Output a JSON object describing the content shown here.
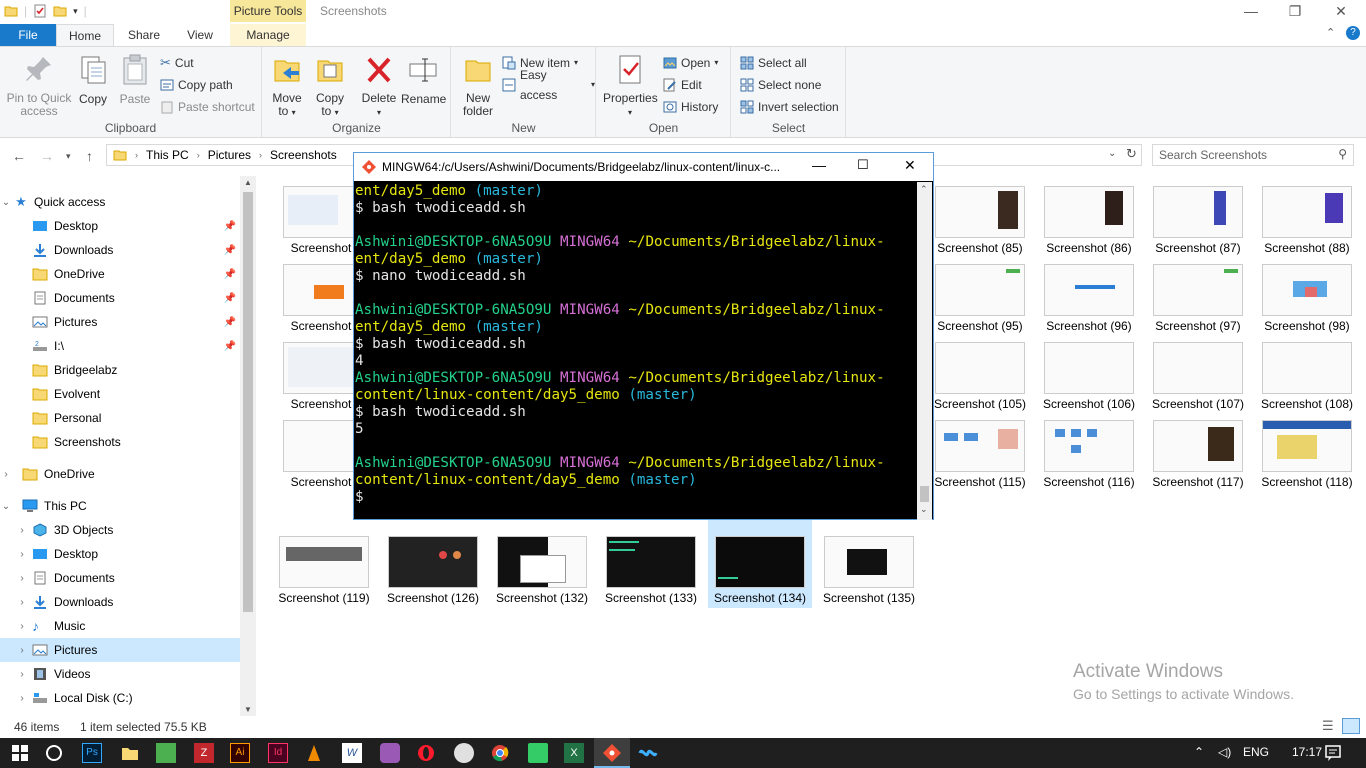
{
  "window": {
    "context_tab": "Picture Tools",
    "title": "Screenshots",
    "min": "—",
    "max": "❐",
    "close": "✕"
  },
  "tabs": {
    "file": "File",
    "home": "Home",
    "share": "Share",
    "view": "View",
    "manage": "Manage"
  },
  "ribbon": {
    "clipboard": {
      "label": "Clipboard",
      "pin": "Pin to Quick access",
      "copy": "Copy",
      "paste": "Paste",
      "cut": "Cut",
      "copy_path": "Copy path",
      "paste_shortcut": "Paste shortcut"
    },
    "organize": {
      "label": "Organize",
      "move_to": "Move to",
      "copy_to": "Copy to",
      "delete": "Delete",
      "rename": "Rename"
    },
    "new": {
      "label": "New",
      "new_folder": "New folder",
      "new_item": "New item",
      "easy_access": "Easy access"
    },
    "open": {
      "label": "Open",
      "properties": "Properties",
      "open": "Open",
      "edit": "Edit",
      "history": "History"
    },
    "select": {
      "label": "Select",
      "select_all": "Select all",
      "select_none": "Select none",
      "invert": "Invert selection"
    }
  },
  "address": {
    "crumbs": [
      "This PC",
      "Pictures",
      "Screenshots"
    ],
    "search_placeholder": "Search Screenshots"
  },
  "sidebar": {
    "quick_access": "Quick access",
    "items": [
      {
        "label": "Desktop",
        "pinned": true
      },
      {
        "label": "Downloads",
        "pinned": true
      },
      {
        "label": "OneDrive",
        "pinned": true
      },
      {
        "label": "Documents",
        "pinned": true
      },
      {
        "label": "Pictures",
        "pinned": true
      },
      {
        "label": "I:\\",
        "pinned": true
      },
      {
        "label": "Bridgeelabz",
        "pinned": false
      },
      {
        "label": "Evolvent",
        "pinned": false
      },
      {
        "label": "Personal",
        "pinned": false
      },
      {
        "label": "Screenshots",
        "pinned": false
      }
    ],
    "onedrive": "OneDrive",
    "this_pc": "This PC",
    "pc_items": [
      "3D Objects",
      "Desktop",
      "Documents",
      "Downloads",
      "Music",
      "Pictures",
      "Videos",
      "Local Disk (C:)"
    ]
  },
  "thumbnails": {
    "row1": [
      "Screenshot (8",
      "Screenshot (85)",
      "Screenshot (86)",
      "Screenshot (87)",
      "Screenshot (88)"
    ],
    "row2": [
      "Screenshot (9",
      "Screenshot (95)",
      "Screenshot (96)",
      "Screenshot (97)",
      "Screenshot (98)"
    ],
    "row3": [
      "Screenshot (1",
      "Screenshot (105)",
      "Screenshot (106)",
      "Screenshot (107)",
      "Screenshot (108)"
    ],
    "row4": [
      "Screenshot (1",
      "Screenshot (115)",
      "Screenshot (116)",
      "Screenshot (117)",
      "Screenshot (118)"
    ],
    "row5": [
      "Screenshot (119)",
      "Screenshot (126)",
      "Screenshot (132)",
      "Screenshot (133)",
      "Screenshot (134)",
      "Screenshot (135)"
    ]
  },
  "terminal": {
    "title": "MINGW64:/c/Users/Ashwini/Documents/Bridgeelabz/linux-content/linux-c...",
    "user": "Ashwini@DESKTOP-6NA5O9U",
    "shell": "MINGW64",
    "lines": {
      "l1_path": "ent/day5_demo",
      "branch": "(master)",
      "cmd1": "$ bash twodiceadd.sh",
      "path_a": "~/Documents/Bridgeelabz/linux-",
      "cmd2": "$ nano twodiceadd.sh",
      "cmd3": "$ bash twodiceadd.sh",
      "out1": "4",
      "path_b": "content/linux-content/day5_demo",
      "cmd4": "$ bash twodiceadd.sh",
      "out2": "5",
      "prompt": "$"
    }
  },
  "status": {
    "count": "46 items",
    "selected": "1 item selected  75.5 KB"
  },
  "watermark": {
    "line1": "Activate Windows",
    "line2": "Go to Settings to activate Windows."
  },
  "tray": {
    "lang": "ENG",
    "time": "17:17"
  }
}
